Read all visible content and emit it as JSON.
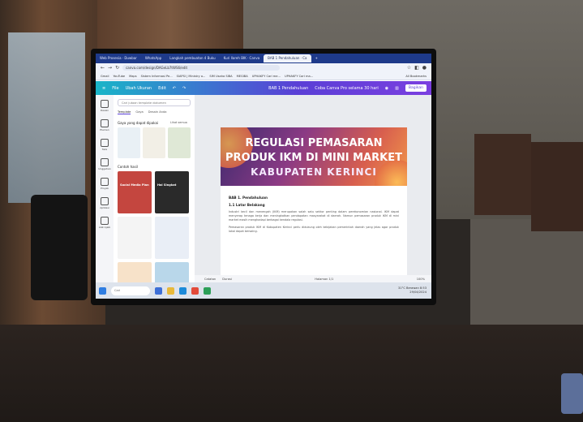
{
  "browser": {
    "tabs": [
      "Web Prosesia · Duwbar",
      "WhatsApp",
      "Langkah pembuatan 4 Buku",
      "Kuri Ilareh BIK · Canva",
      "BAB 1 Pendahuluan · Ca"
    ],
    "active_tab_index": 4,
    "url": "canva.com/design/DAGeLb7tWS6/edit",
    "bookmarks": [
      "Gmail",
      "YouTube",
      "Maps",
      "Sistem Informasi Pe...",
      "SIAPSI | Ministry o...",
      "SIM Usaha SIBA",
      "MEGIBA",
      "UPHAKFY Cari me...",
      "UPHAKFY Cari ma...",
      "All Bookmarks"
    ]
  },
  "canva": {
    "toolbar": {
      "file": "File",
      "resize": "Ubah Ukuran",
      "edit": "Edit",
      "doc_title": "BAB 1 Pendahuluan",
      "trial": "Coba Canva Pro selama 30 hari",
      "share": "Bagikan"
    },
    "rail": [
      "Desain",
      "Elemen",
      "Teks",
      "Unggahan",
      "Proyek",
      "Aplikasi",
      "Alat Ajaib"
    ],
    "panel": {
      "search_placeholder": "Cari jutaan template dokumen",
      "tabs": [
        "Template",
        "Gaya",
        "Desain Anda"
      ],
      "section1": "Gaya yang dapat dipakai",
      "see_all": "Lihat semua",
      "section2": "Contoh hasil",
      "template_labels": [
        "Social Media Plan",
        "Hal Singkat"
      ]
    },
    "banner": {
      "line1": "REGULASI PEMASARAN",
      "line2": "PRODUK IKM DI MINI MARKET",
      "line3": "KABUPATEN KERINCI"
    },
    "body": {
      "heading": "BAB 1. Pendahuluan",
      "subheading": "1.1 Latar Belakang",
      "para1": "Industri kecil dan menengah (IKM) merupakan salah satu sektor penting dalam perekonomian nasional. IKM dapat menyerap tenaga kerja dan meningkatkan pendapatan masyarakat di daerah. Namun pemasaran produk IKM di mini market masih menghadapi berbagai kendala regulasi.",
      "para2": "Pemasaran produk IKM di Kabupaten Kerinci perlu didukung oleh kebijakan pemerintah daerah yang jelas agar produk lokal dapat bersaing."
    },
    "status": {
      "notes": "Catatan",
      "timer": "Durasi",
      "page_info": "Halaman 1/1",
      "zoom": "100%"
    }
  },
  "taskbar": {
    "search": "Cari",
    "time": "8:53",
    "date": "29/04/2024",
    "weather": "31°C Berawan"
  },
  "colors": {
    "canva_gradient_start": "#19b5c8",
    "canva_gradient_end": "#7b3fe0",
    "chrome_tabbar": "#1e3a8a"
  }
}
